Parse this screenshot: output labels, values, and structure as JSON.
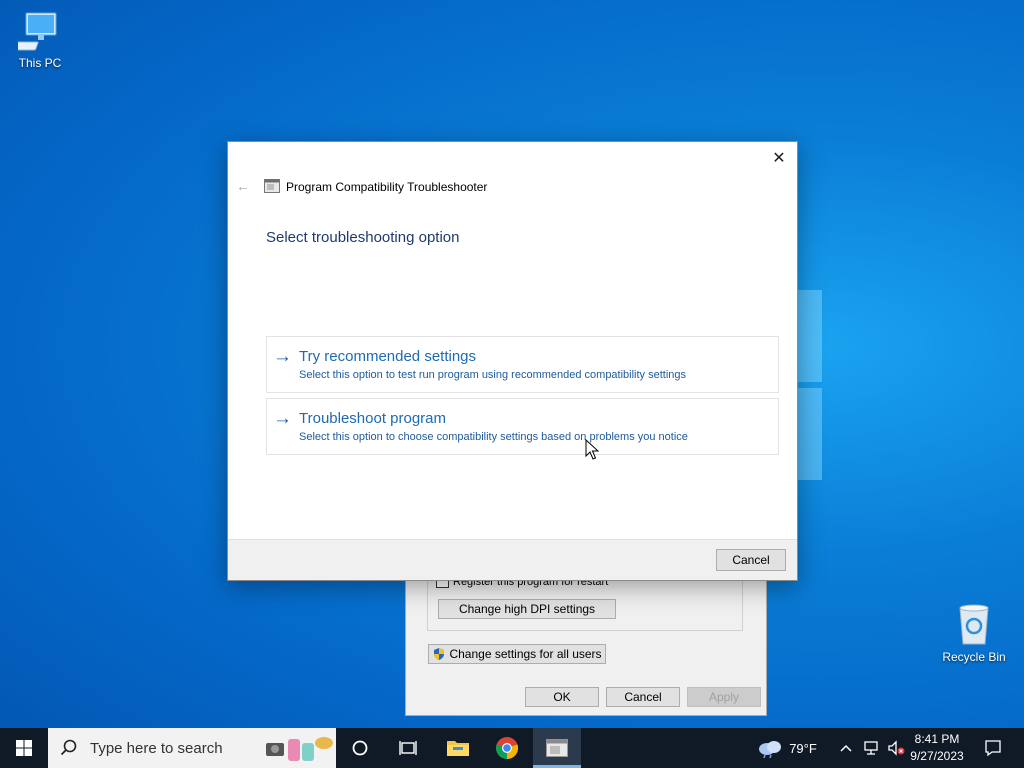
{
  "desktop": {
    "this_pc_label": "This PC",
    "recycle_bin_label": "Recycle Bin"
  },
  "dialog": {
    "title": "Program Compatibility Troubleshooter",
    "heading": "Select troubleshooting option",
    "options": [
      {
        "title": "Try recommended settings",
        "description": "Select this option to test run program using recommended compatibility settings"
      },
      {
        "title": "Troubleshoot program",
        "description": "Select this option to choose compatibility settings based on problems you notice"
      }
    ],
    "cancel_label": "Cancel",
    "close_glyph": "✕",
    "back_glyph": "←",
    "option_arrow_glyph": "→"
  },
  "properties": {
    "register_label": "Register this program for restart",
    "dpi_button": "Change high DPI settings",
    "all_users_button": "Change settings for all users",
    "ok_label": "OK",
    "cancel_label": "Cancel",
    "apply_label": "Apply"
  },
  "taskbar": {
    "search_placeholder": "Type here to search",
    "weather_temp": "79°F",
    "time": "8:41 PM",
    "date": "9/27/2023"
  },
  "colors": {
    "accent": "#1e6ab3",
    "taskbar": "#101a27"
  }
}
